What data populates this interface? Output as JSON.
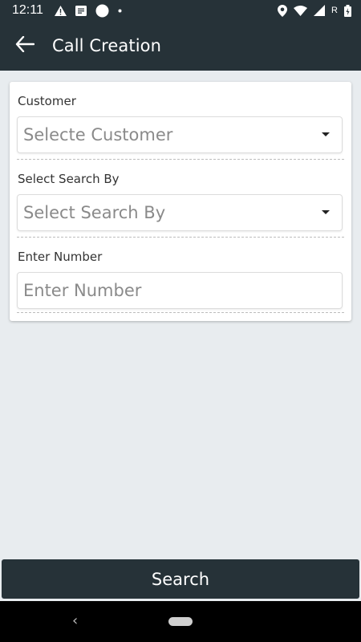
{
  "status_bar": {
    "time": "12:11",
    "left_icons": [
      "warning-icon",
      "message-icon",
      "circle-icon",
      "dot-icon"
    ],
    "right_icons": [
      "location-icon",
      "wifi-icon",
      "signal-icon",
      "battery-icon"
    ],
    "roaming": "R"
  },
  "toolbar": {
    "back_icon": "arrow-left-icon",
    "title": "Call Creation"
  },
  "form": {
    "customer": {
      "label": "Customer",
      "selected": "Selecte Customer"
    },
    "search_by": {
      "label": "Select Search By",
      "selected": "Select Search By"
    },
    "number": {
      "label": "Enter Number",
      "placeholder": "Enter Number"
    }
  },
  "actions": {
    "search_label": "Search"
  },
  "nav_bar": {
    "back_glyph": "‹"
  },
  "colors": {
    "primary_dark": "#263238",
    "background": "#e8ecef",
    "card": "#ffffff"
  }
}
